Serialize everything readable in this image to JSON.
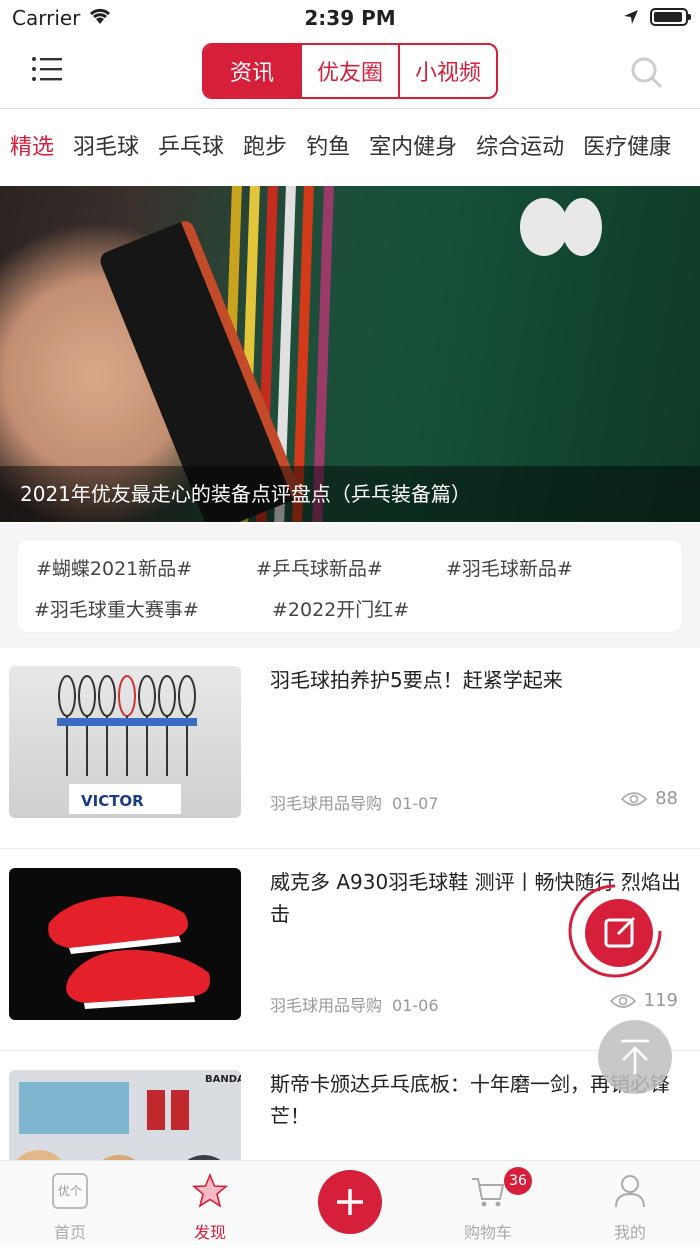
{
  "status_bar": {
    "carrier": "Carrier",
    "time": "2:39 PM"
  },
  "nav": {
    "segments": [
      "资讯",
      "优友圈",
      "小视频"
    ],
    "active_segment": "资讯"
  },
  "categories": [
    "精选",
    "羽毛球",
    "乒乓球",
    "跑步",
    "钓鱼",
    "室内健身",
    "综合运动",
    "医疗健康"
  ],
  "active_category": "精选",
  "banner": {
    "caption": "2021年优友最走心的装备点评盘点（乒乓装备篇）"
  },
  "tags": [
    "#蝴蝶2021新品#",
    "#乒乓球新品#",
    "#羽毛球新品#",
    "#羽毛球重大赛事#",
    "#2022开门红#"
  ],
  "articles": [
    {
      "title": "羽毛球拍养护5要点！赶紧学起来",
      "source": "羽毛球用品导购",
      "date": "01-07",
      "views": "88",
      "thumb_text": "VICTOR"
    },
    {
      "title": "威克多 A930羽毛球鞋 测评丨畅快随行 烈焰出击",
      "source": "羽毛球用品导购",
      "date": "01-06",
      "views": "119"
    },
    {
      "title": "斯帝卡颁达乒乓底板：十年磨一剑，再销必锋芒！",
      "thumb_text": "BANDA"
    }
  ],
  "tabbar": {
    "items": [
      {
        "label": "首页",
        "icon": "logo-icon"
      },
      {
        "label": "发现",
        "icon": "star-icon"
      },
      {
        "label": "",
        "icon": "plus-icon"
      },
      {
        "label": "购物车",
        "icon": "cart-icon"
      },
      {
        "label": "我的",
        "icon": "profile-icon"
      }
    ],
    "active": "发现",
    "cart_badge": "36",
    "home_icon_text": "优个"
  },
  "colors": {
    "accent": "#d61f3b"
  }
}
